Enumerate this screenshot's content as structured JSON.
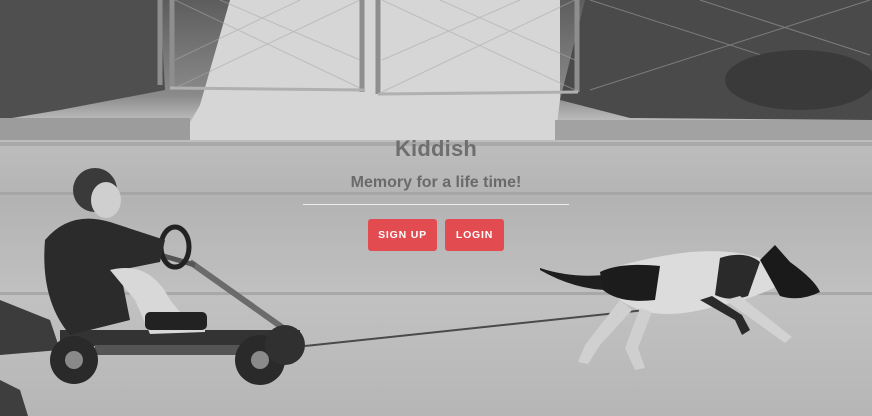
{
  "hero": {
    "title": "Kiddish",
    "subtitle": "Memory for a life time!",
    "colors": {
      "button": "#e24c51",
      "button_text": "#ffffff",
      "title": "#6f6f6f"
    }
  },
  "actions": {
    "signup_label": "SIGN UP",
    "login_label": "LOGIN"
  }
}
